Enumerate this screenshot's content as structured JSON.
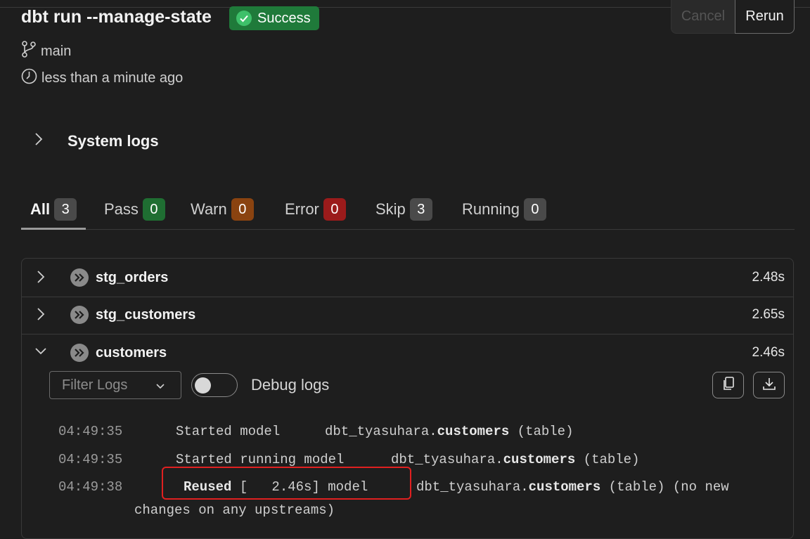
{
  "header": {
    "title": "dbt run --manage-state",
    "status_label": "Success",
    "cancel_label": "Cancel",
    "rerun_label": "Rerun",
    "branch": "main",
    "time_ago": "less than a minute ago"
  },
  "system_logs_label": "System logs",
  "tabs": [
    {
      "label": "All",
      "count": "3",
      "color": "#4a4a4a"
    },
    {
      "label": "Pass",
      "count": "0",
      "color": "#1f6e32"
    },
    {
      "label": "Warn",
      "count": "0",
      "color": "#8a4310"
    },
    {
      "label": "Error",
      "count": "0",
      "color": "#9b1b1b"
    },
    {
      "label": "Skip",
      "count": "3",
      "color": "#4a4a4a"
    },
    {
      "label": "Running",
      "count": "0",
      "color": "#4a4a4a"
    }
  ],
  "models": [
    {
      "name": "stg_orders",
      "duration": "2.48s",
      "expanded": false
    },
    {
      "name": "stg_customers",
      "duration": "2.65s",
      "expanded": false
    },
    {
      "name": "customers",
      "duration": "2.46s",
      "expanded": true
    }
  ],
  "controls": {
    "filter_placeholder": "Filter Logs",
    "debug_label": "Debug logs"
  },
  "logs": [
    {
      "time": "04:49:35",
      "message": "Started model",
      "target_prefix": "dbt_tyasuhara.",
      "target_name": "customers",
      "suffix": " (table)"
    },
    {
      "time": "04:49:35",
      "message": "Started running model",
      "target_prefix": "dbt_tyasuhara.",
      "target_name": "customers",
      "suffix": " (table)"
    },
    {
      "time": "04:49:38",
      "message_bold": "Reused",
      "message": " [   2.46s] model",
      "target_prefix": "dbt_tyasuhara.",
      "target_name": "customers",
      "suffix": " (table) (no new",
      "continuation": "changes on any upstreams)"
    }
  ],
  "icons": [
    "check-icon",
    "branch-icon",
    "clock-icon",
    "chevron-right-icon",
    "chevron-down-icon",
    "skip-icon",
    "copy-icon",
    "download-icon"
  ]
}
